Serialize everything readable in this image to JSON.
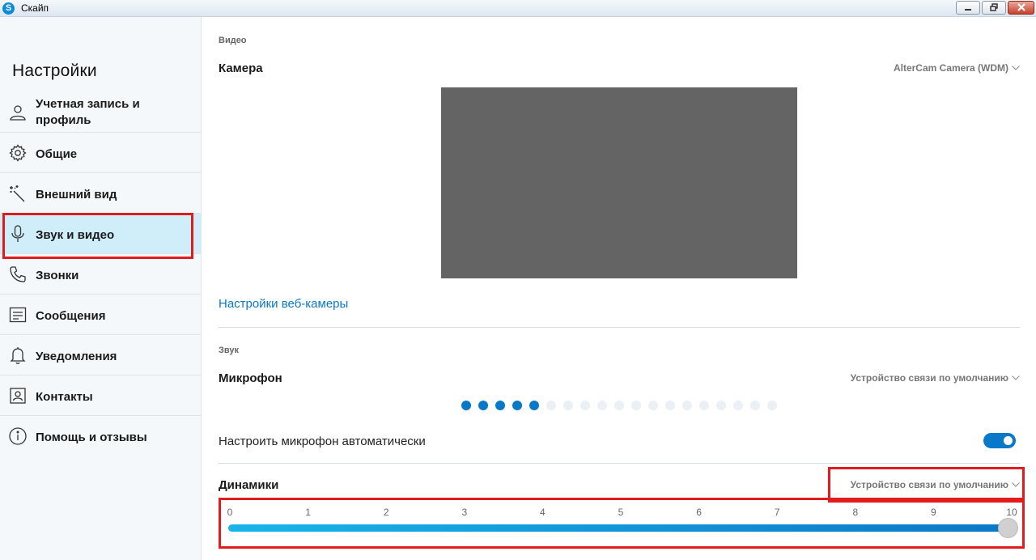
{
  "window": {
    "title": "Скайп",
    "app_icon_letter": "S"
  },
  "sidebar": {
    "title": "Настройки",
    "items": [
      {
        "label": "Учетная запись и профиль",
        "icon": "person-icon"
      },
      {
        "label": "Общие",
        "icon": "gear-icon"
      },
      {
        "label": "Внешний вид",
        "icon": "magic-wand-icon"
      },
      {
        "label": "Звук и видео",
        "icon": "microphone-icon",
        "active": true
      },
      {
        "label": "Звонки",
        "icon": "phone-icon"
      },
      {
        "label": "Сообщения",
        "icon": "message-icon"
      },
      {
        "label": "Уведомления",
        "icon": "bell-icon"
      },
      {
        "label": "Контакты",
        "icon": "contact-card-icon"
      },
      {
        "label": "Помощь и отзывы",
        "icon": "info-icon"
      }
    ]
  },
  "video": {
    "section_label": "Видео",
    "camera_title": "Камера",
    "camera_device": "AlterCam Camera (WDM)",
    "webcam_settings_link": "Настройки веб-камеры"
  },
  "audio": {
    "section_label": "Звук",
    "microphone_title": "Микрофон",
    "microphone_device": "Устройство связи по умолчанию",
    "mic_level_active_dots": 5,
    "mic_level_total_dots": 19,
    "auto_adjust_label": "Настроить микрофон автоматически",
    "auto_adjust_enabled": true,
    "speakers_title": "Динамики",
    "speakers_device": "Устройство связи по умолчанию",
    "speaker_volume_ticks": [
      "0",
      "1",
      "2",
      "3",
      "4",
      "5",
      "6",
      "7",
      "8",
      "9",
      "10"
    ],
    "speaker_volume": 10
  },
  "colors": {
    "accent": "#0a78c8",
    "active_nav": "#cfeefa",
    "highlight": "#e11c1c"
  }
}
